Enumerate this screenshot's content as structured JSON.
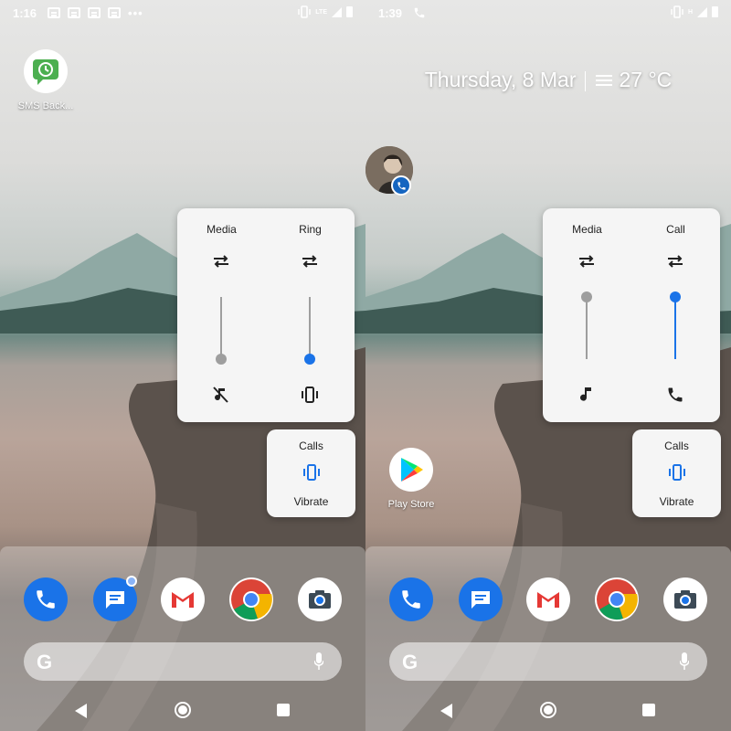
{
  "left": {
    "status": {
      "time": "1:16",
      "dots": "•••",
      "lte": "LTE"
    },
    "app": {
      "label": "SMS Back..."
    },
    "panel": {
      "col1": {
        "title": "Media",
        "level": 0,
        "icon": "music-off-icon"
      },
      "col2": {
        "title": "Ring",
        "level": 0,
        "icon": "vibrate-icon"
      }
    },
    "mini": {
      "title": "Calls",
      "icon": "vibrate-icon",
      "label": "Vibrate"
    }
  },
  "right": {
    "status": {
      "time": "1:39",
      "network": "H"
    },
    "widget": {
      "date": "Thursday, 8 Mar",
      "temp": "27 °C"
    },
    "app": {
      "label": "Play Store"
    },
    "panel": {
      "col1": {
        "title": "Media",
        "level": 1.0,
        "icon": "music-note-icon"
      },
      "col2": {
        "title": "Call",
        "level": 1.0,
        "icon": "phone-icon"
      }
    },
    "mini": {
      "title": "Calls",
      "icon": "vibrate-icon",
      "label": "Vibrate"
    }
  },
  "dock_apps": [
    "phone",
    "messages",
    "gmail",
    "chrome",
    "camera"
  ],
  "search": {
    "logo": "G"
  },
  "colors": {
    "accent": "#1a73e8",
    "panel": "#f5f5f5"
  }
}
